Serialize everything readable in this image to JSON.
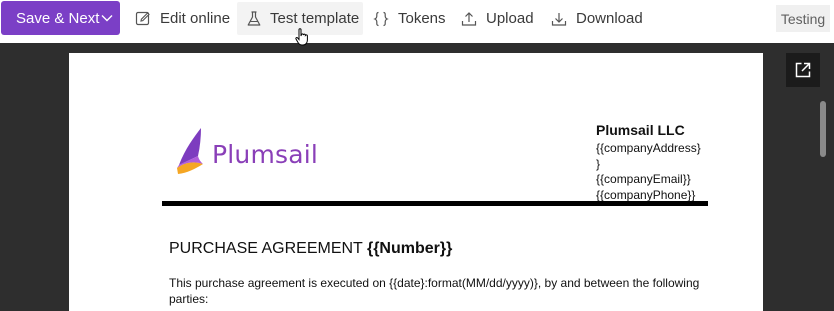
{
  "toolbar": {
    "primary_button": {
      "label": "Save & Next",
      "color": "#7b3fc6"
    },
    "items": [
      {
        "label": "Edit online",
        "icon": "edit-icon"
      },
      {
        "label": "Test template",
        "icon": "flask-icon"
      },
      {
        "label": "Tokens",
        "icon": "braces-icon"
      },
      {
        "label": "Upload",
        "icon": "upload-icon"
      },
      {
        "label": "Download",
        "icon": "download-icon"
      }
    ],
    "status_badge": "Testing"
  },
  "viewer": {
    "popout_icon": "open-in-new-window-icon",
    "document": {
      "logo_text": "Plumsail",
      "company_name": "Plumsail LLC",
      "company_lines": [
        "{{companyAddress}",
        "}",
        "{{companyEmail}}",
        "{{companyPhone}}"
      ],
      "title_plain": "PURCHASE AGREEMENT ",
      "title_token": "{{Number}}",
      "paragraph": "This purchase agreement is executed on {{date}:format(MM/dd/yyyy)}, by and between the following parties:"
    }
  }
}
